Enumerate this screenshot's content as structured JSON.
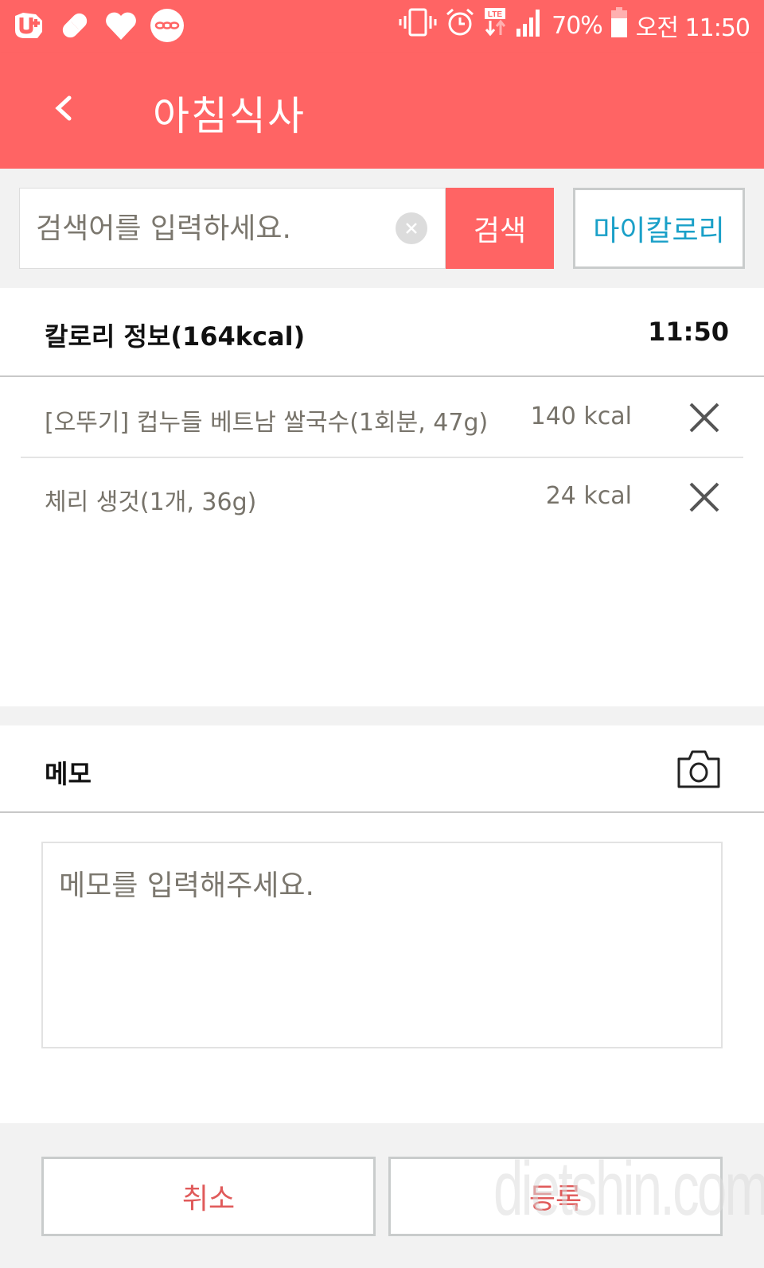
{
  "status_bar": {
    "left_icons": [
      "uplus-icon",
      "pill-icon",
      "heart-icon",
      "chain-link-icon"
    ],
    "right_icons": [
      "vibrate-icon",
      "alarm-icon",
      "lte-icon",
      "signal-icon"
    ],
    "battery": "70%",
    "time": "오전 11:50"
  },
  "app_bar": {
    "back_icon": "chevron-left-icon",
    "title": "아침식사"
  },
  "search": {
    "placeholder": "검색어를 입력하세요.",
    "value": "",
    "clear_icon": "clear-circle-icon",
    "search_label": "검색",
    "my_calorie_label": "마이칼로리"
  },
  "calorie_info": {
    "title": "칼로리 정보(164kcal)",
    "time": "11:50",
    "items": [
      {
        "name": "[오뚜기] 컵누들 베트남 쌀국수(1회분, 47g)",
        "kcal": "140 kcal"
      },
      {
        "name": "체리 생것(1개, 36g)",
        "kcal": "24 kcal"
      }
    ]
  },
  "memo": {
    "title": "메모",
    "camera_icon": "camera-icon",
    "placeholder": "메모를 입력해주세요.",
    "value": ""
  },
  "footer": {
    "cancel_label": "취소",
    "submit_label": "등록"
  },
  "watermark": "dietshin.com",
  "colors": {
    "primary": "#ff6464",
    "accent_blue": "#1aa0c8",
    "button_text": "#e05a5a",
    "muted_text": "#77736a"
  }
}
